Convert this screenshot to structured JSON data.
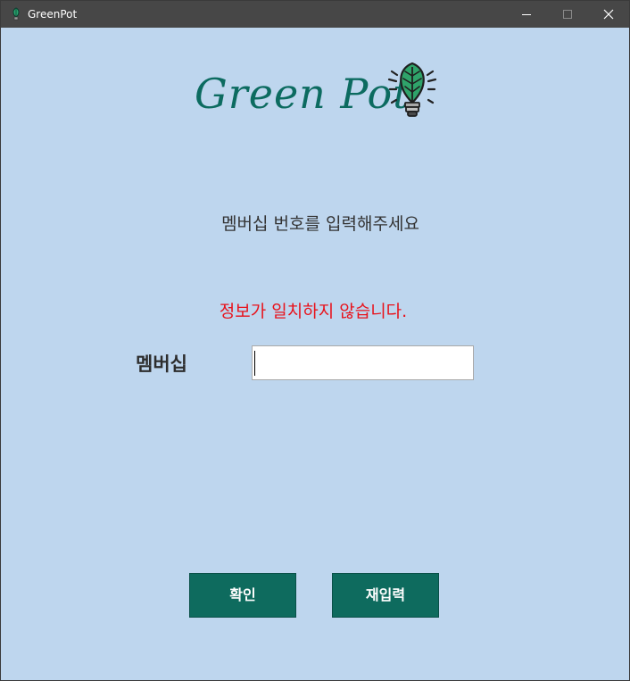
{
  "window": {
    "title": "GreenPot"
  },
  "logo": {
    "text": "Green Pot"
  },
  "form": {
    "prompt": "멤버십 번호를 입력해주세요",
    "error": "정보가 일치하지 않습니다.",
    "member_label": "멤버십",
    "member_value": "",
    "member_placeholder": ""
  },
  "buttons": {
    "confirm_label": "확인",
    "reenter_label": "재입력"
  },
  "colors": {
    "background": "#bed6ee",
    "titlebar": "#474747",
    "brand_green": "#0e6b5e",
    "error_red": "#e8121b"
  },
  "icons": {
    "app": "leaf-bulb-icon",
    "logo": "leaf-bulb-icon",
    "minimize": "minimize-icon",
    "maximize": "maximize-icon",
    "close": "close-icon"
  }
}
